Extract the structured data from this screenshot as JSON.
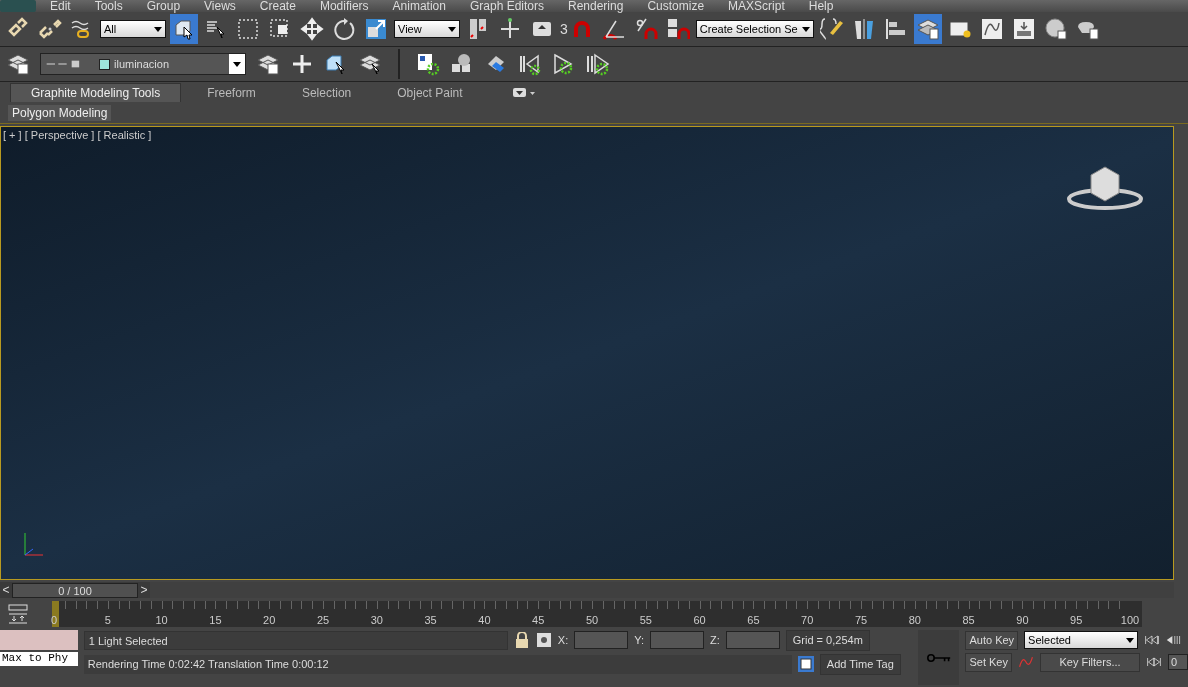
{
  "menu_bar": [
    "Edit",
    "Tools",
    "Group",
    "Views",
    "Create",
    "Modifiers",
    "Animation",
    "Graph Editors",
    "Rendering",
    "Customize",
    "MAXScript",
    "Help"
  ],
  "main_toolbar": [
    {
      "kind": "button",
      "selected": false
    },
    {
      "kind": "button",
      "selected": false
    },
    {
      "kind": "button",
      "selected": false
    },
    {
      "kind": "dropdown",
      "value": "All"
    },
    {
      "kind": "button",
      "selected": true
    },
    {
      "kind": "button",
      "selected": false
    },
    {
      "kind": "button",
      "selected": false
    },
    {
      "kind": "button",
      "selected": false
    },
    {
      "kind": "button",
      "selected": false
    },
    {
      "kind": "button",
      "selected": false
    },
    {
      "kind": "button",
      "selected": false
    },
    {
      "kind": "dropdown",
      "value": "View"
    },
    {
      "kind": "button",
      "selected": false
    },
    {
      "kind": "button",
      "selected": false
    },
    {
      "kind": "button",
      "selected": false
    },
    {
      "kind": "snap",
      "value": "3"
    },
    {
      "kind": "button",
      "selected": false
    },
    {
      "kind": "button",
      "selected": false
    },
    {
      "kind": "button",
      "selected": false
    },
    {
      "kind": "button",
      "selected": false
    },
    {
      "kind": "dropdown",
      "value": "Create Selection Se"
    },
    {
      "kind": "button",
      "selected": false
    },
    {
      "kind": "button",
      "selected": false
    },
    {
      "kind": "button",
      "selected": false
    },
    {
      "kind": "button",
      "selected": true
    },
    {
      "kind": "button",
      "selected": false
    },
    {
      "kind": "button",
      "selected": false
    },
    {
      "kind": "button",
      "selected": false
    },
    {
      "kind": "button",
      "selected": false
    },
    {
      "kind": "button",
      "selected": false
    }
  ],
  "layer_toolbar": {
    "layer": "iluminacion",
    "color": "#9ee6dc"
  },
  "ribbon": {
    "tabs": [
      {
        "label": "Graphite Modeling Tools",
        "selected": true
      },
      {
        "label": "Freeform",
        "selected": false
      },
      {
        "label": "Selection",
        "selected": false
      },
      {
        "label": "Object Paint",
        "selected": false
      }
    ],
    "panel": "Polygon Modeling"
  },
  "viewport": {
    "label": "[ + ] [ Perspective ] [ Realistic ]"
  },
  "time_slider": {
    "prev": "<",
    "frame": "0 / 100",
    "next": ">",
    "level": 0
  },
  "track_bar": {
    "ticks": [
      "0",
      "5",
      "10",
      "15",
      "20",
      "25",
      "30",
      "35",
      "40",
      "45",
      "50",
      "55",
      "60",
      "65",
      "70",
      "75",
      "80",
      "85",
      "90",
      "95",
      "100"
    ]
  },
  "listener": {
    "value": "Max to Phy"
  },
  "status_bar": {
    "selection": "1 Light Selected",
    "x_label": "X:",
    "y_label": "Y:",
    "z_label": "Z:",
    "grid": "Grid = 0,254m",
    "prompt": "Rendering Time  0:02:42     Translation Time  0:00:12",
    "time_tag": "Add Time Tag",
    "auto_key": "Auto Key",
    "key_mode": "Selected",
    "set_key": "Set Key",
    "key_filters": "Key Filters...",
    "frame": "0"
  }
}
